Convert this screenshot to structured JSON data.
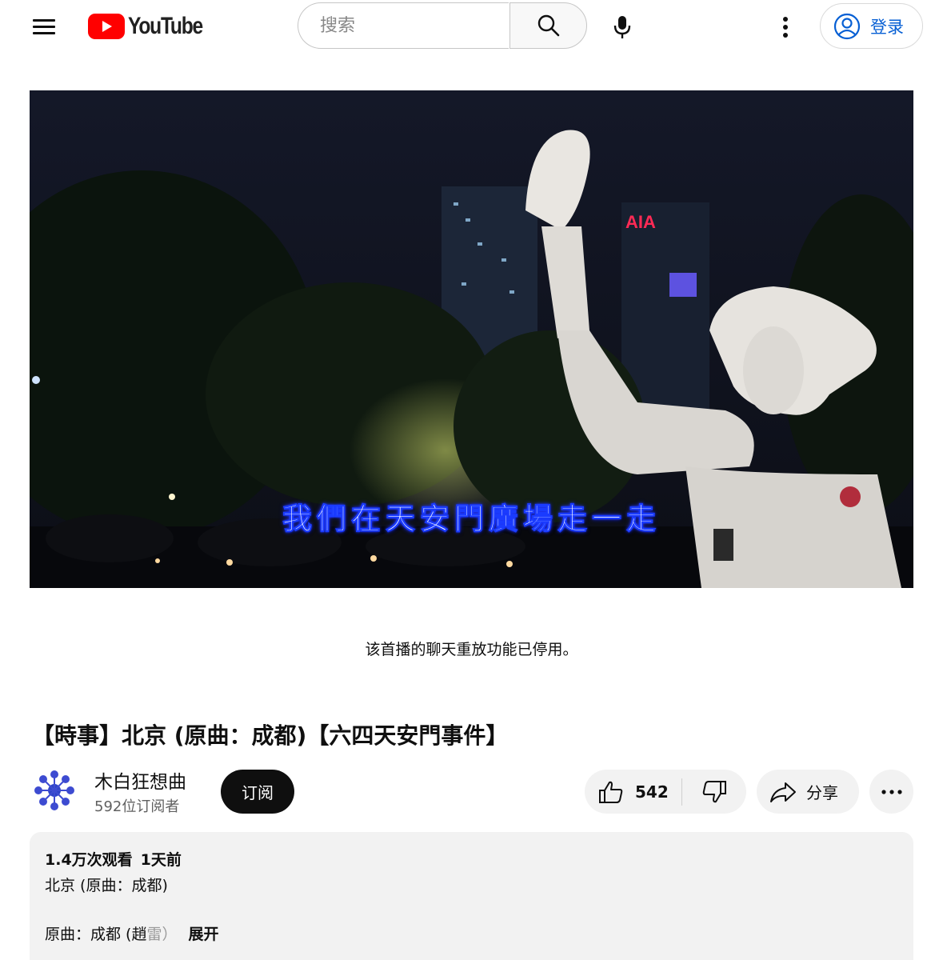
{
  "header": {
    "logo_text": "YouTube",
    "search_placeholder": "搜索",
    "signin_label": "登录"
  },
  "icons": {
    "menu": "hamburger-menu-icon",
    "logo": "youtube-play-icon",
    "search": "search-icon",
    "mic": "microphone-icon",
    "more": "more-vertical-icon",
    "account": "account-circle-icon",
    "like": "thumbs-up-icon",
    "dislike": "thumbs-down-icon",
    "share": "share-arrow-icon",
    "more_actions": "more-horizontal-icon"
  },
  "colors": {
    "brand_red": "#ff0000",
    "link_blue": "#065fd4",
    "chip_bg": "#f2f2f2"
  },
  "player": {
    "subtitle": "我們在天安門廣場走一走"
  },
  "chat": {
    "replay_disabled": "该首播的聊天重放功能已停用。"
  },
  "video": {
    "title": "【時事】北京 (原曲：成都)【六四天安門事件】",
    "channel_name": "木白狂想曲",
    "subscribers": "592位订阅者",
    "subscribe_label": "订阅",
    "likes": "542",
    "share_label": "分享"
  },
  "description": {
    "views": "1.4万次观看",
    "time_ago": "1天前",
    "line1": "北京 (原曲：成都)",
    "line2_main": "原曲：成都 (趙",
    "line2_faded": "雷）",
    "expand_label": "展开"
  }
}
